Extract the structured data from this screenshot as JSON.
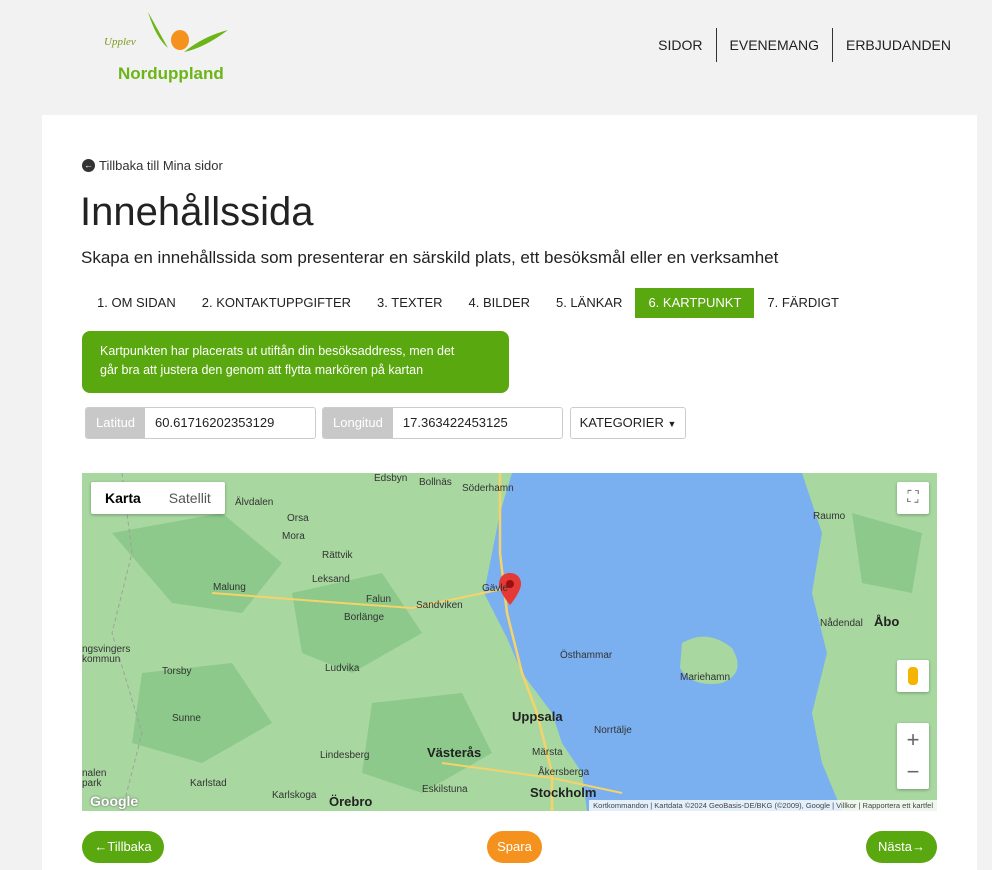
{
  "brand": {
    "script": "Upplev",
    "name": "Norduppland"
  },
  "nav": {
    "items": [
      "SIDOR",
      "EVENEMANG",
      "ERBJUDANDEN"
    ]
  },
  "back_link": "Tillbaka till Mina sidor",
  "page": {
    "title": "Innehållssida",
    "subtitle": "Skapa en innehållssida som presenterar en särskild plats, ett besöksmål eller en verksamhet"
  },
  "tabs": [
    "1. OM SIDAN",
    "2. KONTAKTUPPGIFTER",
    "3. TEXTER",
    "4. BILDER",
    "5. LÄNKAR",
    "6. KARTPUNKT",
    "7. FÄRDIGT"
  ],
  "active_tab": "6. KARTPUNKT",
  "info": {
    "line1": "Kartpunkten har placerats ut utiftån din besöksaddress, men det",
    "line2": "går bra att justera den genom att flytta markören på kartan"
  },
  "coords": {
    "lat_label": "Latitud",
    "lat_value": "60.61716202353129",
    "lon_label": "Longitud",
    "lon_value": "17.363422453125"
  },
  "categories_label": "KATEGORIER",
  "map": {
    "type_map": "Karta",
    "type_satellite": "Satellit",
    "zoom_in": "+",
    "zoom_out": "−",
    "logo": "Google",
    "attribution": "Kortkommandon | Kartdata ©2024 GeoBasis-DE/BKG (©2009), Google | Villkor | Rapportera ett kartfel",
    "cities": [
      "Edsbyn",
      "Bollnäs",
      "Söderhamn",
      "Älvdalen",
      "Orsa",
      "Mora",
      "Rättvik",
      "Leksand",
      "Malung",
      "Falun",
      "Borlänge",
      "Sandviken",
      "Gävle",
      "Ludvika",
      "Torsby",
      "Sunne",
      "Lindesberg",
      "Västerås",
      "Uppsala",
      "Märsta",
      "Norrtälje",
      "Åkersberga",
      "Östhammar",
      "Mariehamn",
      "Raumo",
      "Nådendal",
      "Åbo",
      "Karlstad",
      "Karlskoga",
      "Örebro",
      "Eskilstuna",
      "Stockholm",
      "ngsvingers kommun",
      "nalen park"
    ],
    "major_cities": [
      "Uppsala",
      "Västerås",
      "Stockholm",
      "Åbo"
    ],
    "colors": {
      "water": "#7ab0f0",
      "land": "#a8d8a0",
      "forest": "#8cc98a",
      "road": "#f5d36a",
      "marker": "#e53935"
    }
  },
  "footer": {
    "back": "Tillbaka",
    "save": "Spara",
    "next": "Nästa"
  },
  "colors": {
    "accent": "#5aa80f",
    "orange": "#f5921e"
  }
}
